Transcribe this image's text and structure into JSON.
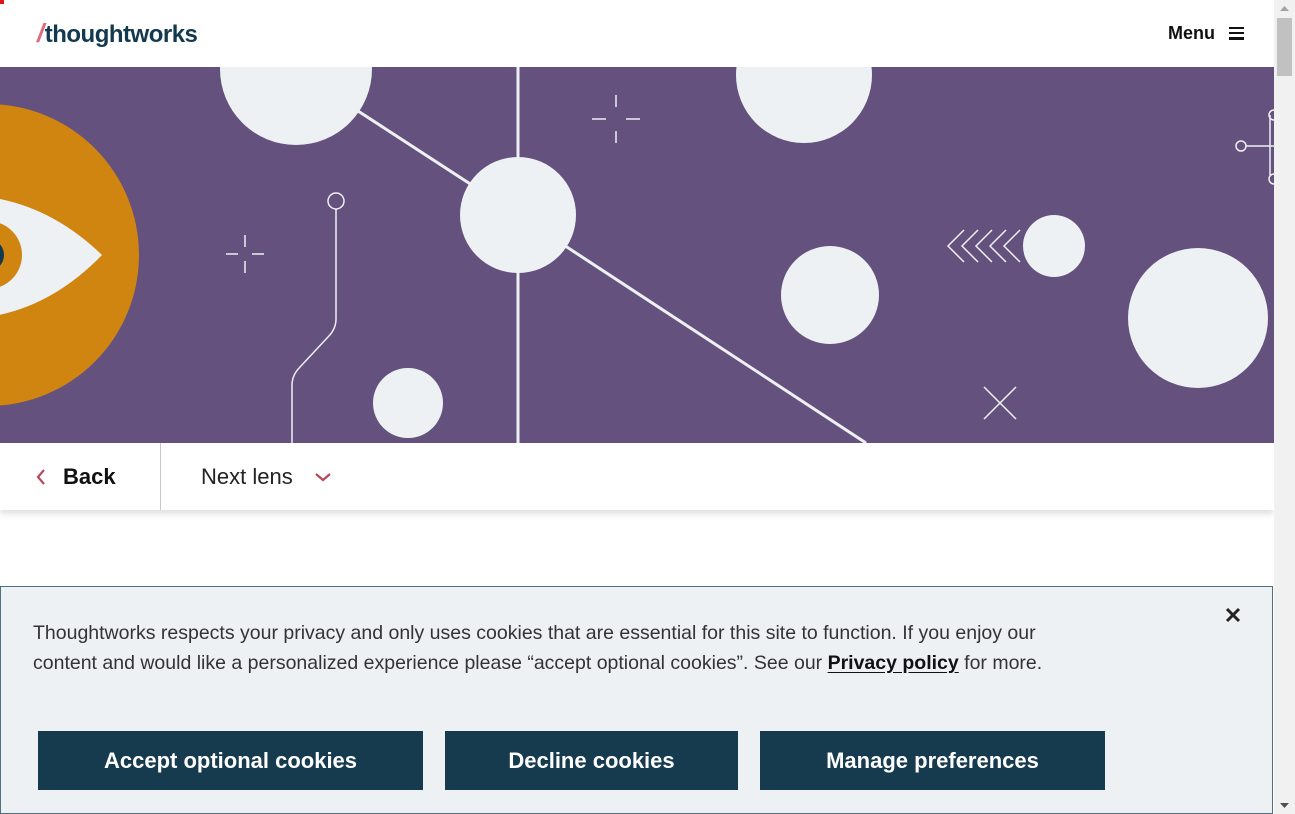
{
  "header": {
    "logo_slash": "/",
    "logo_text": "thoughtworks",
    "menu_label": "Menu"
  },
  "lens_nav": {
    "back_label": "Back",
    "next_label": "Next lens"
  },
  "cookie_banner": {
    "text_before": "Thoughtworks respects your privacy and only uses cookies that are essential for this site to function. If you enjoy our content and would like a personalized experience please “accept optional cookies”. See our ",
    "link_label": "Privacy policy",
    "text_after": " for more.",
    "accept_label": "Accept optional cookies",
    "decline_label": "Decline cookies",
    "manage_label": "Manage preferences"
  },
  "icons": {
    "menu": "hamburger-icon",
    "back": "chevron-left-icon",
    "next": "chevron-down-icon",
    "close": "close-icon"
  },
  "colors": {
    "hero_background": "#64517e",
    "accent": "#b84a5e",
    "button_background": "#163b4f",
    "cookie_background": "#edf1f3",
    "eye_orange": "#cf850f",
    "logo_text": "#13394e"
  }
}
